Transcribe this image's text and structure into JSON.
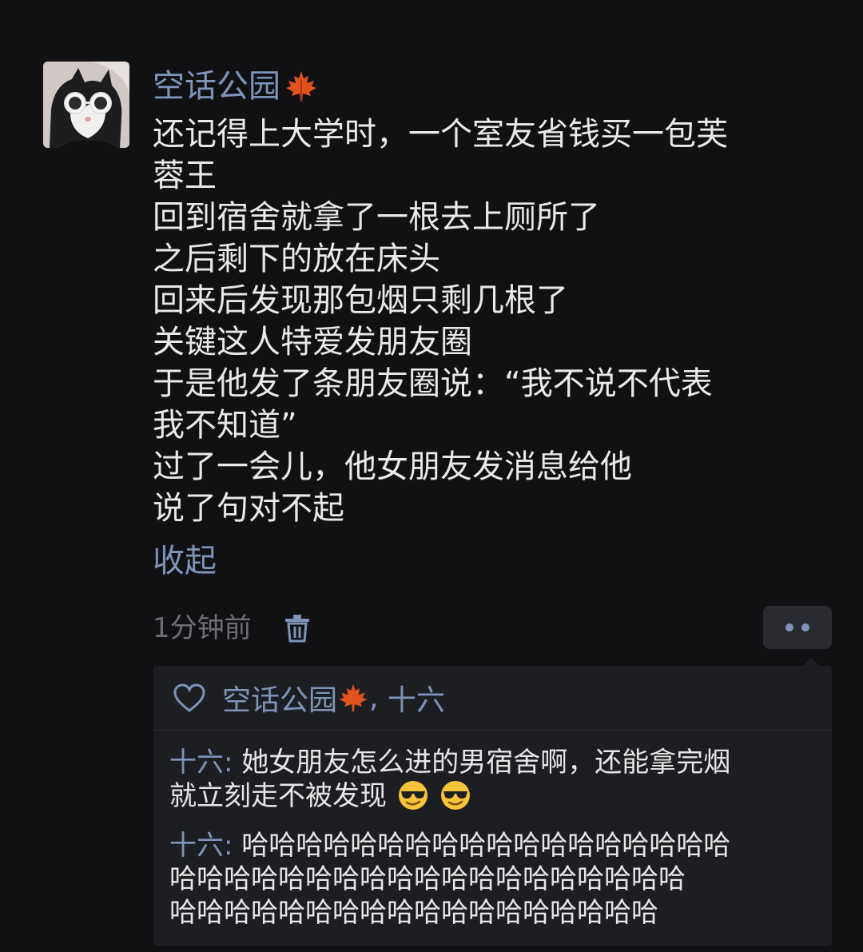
{
  "post": {
    "username": "空话公园",
    "username_emoji": "maple-leaf-icon",
    "body_lines": [
      "还记得上大学时，一个室友省钱买一包芙",
      "蓉王",
      "回到宿舍就拿了一根去上厕所了",
      "之后剩下的放在床头",
      "回来后发现那包烟只剩几根了",
      "关键这人特爱发朋友圈",
      "于是他发了条朋友圈说：“我不说不代表",
      "我不知道”",
      "过了一会儿，他女朋友发消息给他",
      "说了句对不起"
    ],
    "collapse_label": "收起",
    "timestamp": "1分钟前"
  },
  "likes": {
    "names": [
      "空话公园",
      "十六"
    ],
    "separator": ", "
  },
  "comments": [
    {
      "author": "十六",
      "text_line1": "她女朋友怎么进的男宿舍啊，还能拿完烟",
      "text_line2": "就立刻走不被发现"
    },
    {
      "author": "十六",
      "text_line1": "哈哈哈哈哈哈哈哈哈哈哈哈哈哈哈哈哈哈",
      "text_line2": "哈哈哈哈哈哈哈哈哈哈哈哈哈哈哈哈哈哈哈",
      "text_line3": "哈哈哈哈哈哈哈哈哈哈哈哈哈哈哈哈哈哈"
    }
  ],
  "colors": {
    "background": "#111113",
    "link_blue": "#7e94b8",
    "text": "#e9e9e9",
    "muted": "#6f6f73",
    "panel": "#1d1e22"
  }
}
